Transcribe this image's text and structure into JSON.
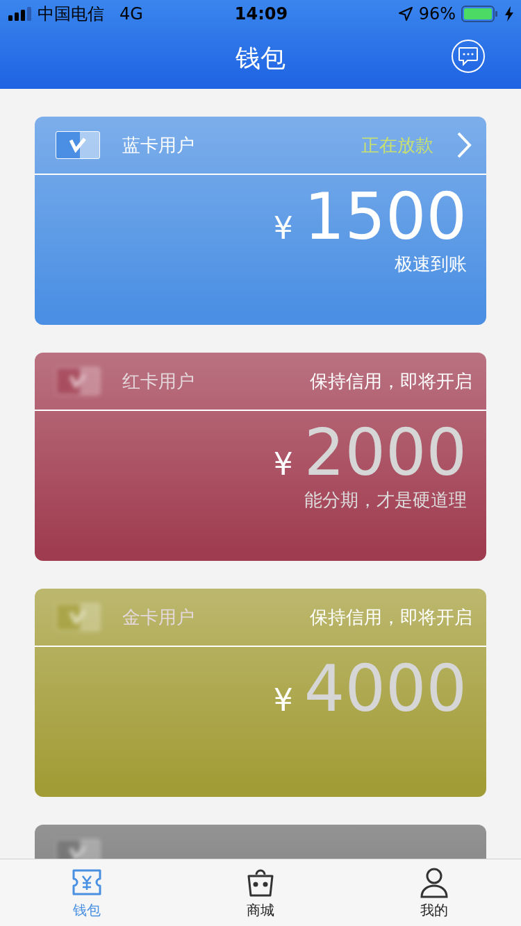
{
  "status_bar": {
    "carrier": "中国电信",
    "network": "4G",
    "time": "14:09",
    "battery": "96%"
  },
  "nav": {
    "title": "钱包"
  },
  "cards": [
    {
      "name": "蓝卡用户",
      "status": "正在放款",
      "currency": "¥",
      "amount": "1500",
      "subtitle": "极速到账",
      "locked": false,
      "color": "#4a8fe3"
    },
    {
      "name": "红卡用户",
      "status": "保持信用，即将开启",
      "currency": "¥",
      "amount": "2000",
      "subtitle": "能分期，才是硬道理",
      "locked": true,
      "color": "#a03c50"
    },
    {
      "name": "金卡用户",
      "status": "保持信用，即将开启",
      "currency": "¥",
      "amount": "4000",
      "locked": true,
      "color": "#a29c36"
    },
    {
      "locked": true,
      "color": "#6a6a6a"
    }
  ],
  "tabs": [
    {
      "label": "钱包",
      "kind": "wallet",
      "selected": true
    },
    {
      "label": "商城",
      "kind": "shop",
      "selected": false
    },
    {
      "label": "我的",
      "kind": "profile",
      "selected": false
    }
  ]
}
